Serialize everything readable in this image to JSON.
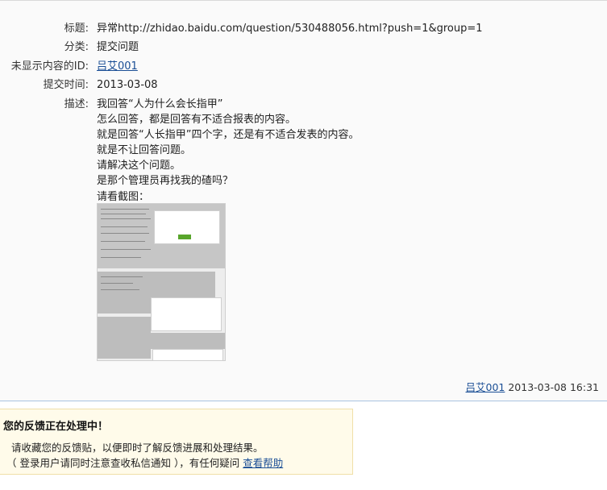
{
  "details": {
    "title_label": "标题:",
    "title_value": "异常http://zhidao.baidu.com/question/530488056.html?push=1&group=1",
    "category_label": "分类:",
    "category_value": "提交问题",
    "hidden_id_label": "未显示内容的ID:",
    "hidden_id_value": "吕艾001",
    "submit_time_label": "提交时间:",
    "submit_time_value": "2013-03-08",
    "description_label": "描述:",
    "description_lines": [
      "我回答“人为什么会长指甲”",
      "怎么回答，都是回答有不适合报表的内容。",
      "就是回答“人长指甲”四个字，还是有不适合发表的内容。",
      "就是不让回答问题。",
      "请解决这个问题。",
      "是那个管理员再找我的碴吗？",
      "请看截图："
    ]
  },
  "post_meta": {
    "author": "吕艾001",
    "timestamp": "2013-03-08 16:31"
  },
  "notice": {
    "title": "您的反馈正在处理中！",
    "line1": "请收藏您的反馈贴，以便即时了解反馈进展和处理结果。",
    "line2_prefix": "（ 登录用户请同时注意查收私信通知 ），有任何疑问",
    "help_link": "查看帮助"
  },
  "colors": {
    "link": "#1a4e95",
    "notice_bg": "#fffbea",
    "divider": "#aac4e0"
  }
}
